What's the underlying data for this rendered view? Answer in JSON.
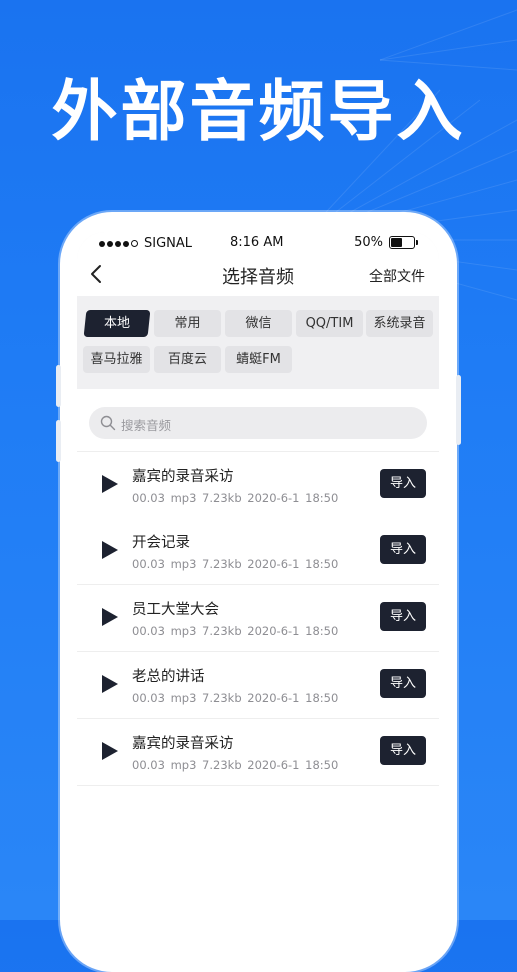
{
  "banner": {
    "headline": "外部音频导入"
  },
  "status_bar": {
    "carrier": "SIGNAL",
    "time": "8:16 AM",
    "battery": "50%"
  },
  "nav": {
    "title": "选择音频",
    "right_action": "全部文件"
  },
  "tabs": [
    {
      "label": "本地",
      "active": true
    },
    {
      "label": "常用",
      "active": false
    },
    {
      "label": "微信",
      "active": false
    },
    {
      "label": "QQ/TIM",
      "active": false
    },
    {
      "label": "系统录音",
      "active": false
    },
    {
      "label": "喜马拉雅",
      "active": false
    },
    {
      "label": "百度云",
      "active": false
    },
    {
      "label": "蜻蜓FM",
      "active": false
    }
  ],
  "search": {
    "placeholder": "搜索音频"
  },
  "files": [
    {
      "title": "嘉宾的录音采访",
      "meta": "00.03  mp3  7.23kb  2020-6-1  18:50",
      "action": "导入"
    },
    {
      "title": "开会记录",
      "meta": "00.03  mp3  7.23kb  2020-6-1  18:50",
      "action": "导入"
    },
    {
      "title": "员工大堂大会",
      "meta": "00.03  mp3  7.23kb  2020-6-1  18:50",
      "action": "导入"
    },
    {
      "title": "老总的讲话",
      "meta": "00.03  mp3  7.23kb  2020-6-1  18:50",
      "action": "导入"
    },
    {
      "title": "嘉宾的录音采访",
      "meta": "00.03  mp3  7.23kb  2020-6-1  18:50",
      "action": "导入"
    }
  ],
  "colors": {
    "background": "#1f7cf5",
    "accent_dark": "#1d2230"
  }
}
